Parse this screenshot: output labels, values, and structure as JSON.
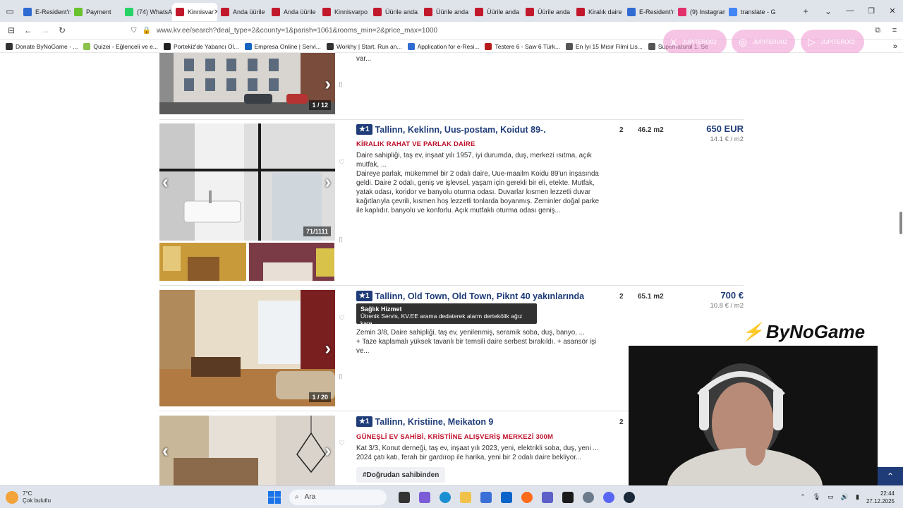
{
  "browser": {
    "tabs": [
      {
        "label": "E-Resident'n",
        "color": "#2f6bd2"
      },
      {
        "label": "Payment",
        "color": "#6ac22e"
      },
      {
        "label": "(74) WhatsA",
        "color": "#25d366"
      },
      {
        "label": "Kinnisvar",
        "color": "#c2182c",
        "active": true
      },
      {
        "label": "Anda üürile",
        "color": "#c2182c"
      },
      {
        "label": "Anda üürile",
        "color": "#c2182c"
      },
      {
        "label": "Kinnisvarpo",
        "color": "#c2182c"
      },
      {
        "label": "Üürile anda",
        "color": "#c2182c"
      },
      {
        "label": "Üürile anda",
        "color": "#c2182c"
      },
      {
        "label": "Üürile anda",
        "color": "#c2182c"
      },
      {
        "label": "Üürile anda",
        "color": "#c2182c"
      },
      {
        "label": "Kiralık daire",
        "color": "#c2182c"
      },
      {
        "label": "E-Resident'n",
        "color": "#2f6bd2"
      },
      {
        "label": "(9) Instagran",
        "color": "#e1306c"
      },
      {
        "label": "translate - G",
        "color": "#4285f4"
      }
    ],
    "url": "www.kv.ee/search?deal_type=2&county=1&parish=1061&rooms_min=2&price_max=1000",
    "bookmarks": [
      {
        "label": "Donate ByNoGame - ...",
        "color": "#333"
      },
      {
        "label": "Quizei - Eğlenceli ve e...",
        "color": "#8bc34a"
      },
      {
        "label": "Portekiz'de Yabancı Ol...",
        "color": "#222"
      },
      {
        "label": "Empresa Online | Servi...",
        "color": "#1565c0"
      },
      {
        "label": "Workhy | Start, Run an...",
        "color": "#333"
      },
      {
        "label": "Application for e-Resi...",
        "color": "#2f6bd2"
      },
      {
        "label": "Testere 6 - Saw 6 Türk...",
        "color": "#b71c1c"
      },
      {
        "label": "En İyi 15 Mısır Filmi Lis...",
        "color": "#555"
      },
      {
        "label": "Supernatural 1. Se",
        "color": "#555"
      }
    ],
    "social": [
      {
        "icon": "X",
        "handle": "JUPITERO02"
      },
      {
        "icon": "◎",
        "handle": "JUPITERO02"
      },
      {
        "icon": "▷",
        "handle": "JUPITERO02"
      }
    ]
  },
  "listings": [
    {
      "title": "",
      "subtitle": "",
      "desc": "var...",
      "counter": "1 / 12"
    },
    {
      "rank": "1",
      "title": "Tallinn, Keklinn, Uus-postam, Koidut 89-.",
      "subtitle": "KİRALIK RAHAT VE PARLAK DAİRE",
      "desc": "Daire sahipliği, taş ev, inşaat yılı 1957, iyi durumda, duş, merkezi ısıtma, açık mutfak, ...\nDaireye parlak, mükemmel bir 2 odalı daire, Uue-maailm Koidu 89'un inşasında geldi. Daire 2 odalı, geniş ve işlevsel, yaşam için gerekli bir eli, etekte. Mutfak, yatak odası, koridor ve banyolu oturma odası. Duvarlar kısmen lezzetli duvar kağıtlarıyla çevrili, kısmen hoş lezzetli tonlarda boyanmış. Zeminler doğal parke ile kaplıdır. banyolu ve konforlu. Açık mutfaklı oturma odası geniş...",
      "rooms": "2",
      "area": "46.2 m2",
      "price": "650 EUR",
      "price_m2": "14.1 € / m2",
      "counter": "71/1111"
    },
    {
      "rank": "1",
      "title": "Tallinn, Old Town, Old Town, Piknt 40 yakınlarında",
      "subtitle": "",
      "desc": "Zemin 3/8, Daire sahipliği, taş ev, yenilenmiş, seramik soba, duş, banyo, ...\n+ Taze kaplamalı yüksek tavanlı bir temsili daire serbest bırakıldı. + asansör işi ve...",
      "rooms": "2",
      "area": "65.1 m2",
      "price": "700 €",
      "price_m2": "10.8 € / m2",
      "counter": "1 / 20"
    },
    {
      "rank": "1",
      "title": "Tallinn, Kristiine, Meikaton 9",
      "subtitle": "GÜNEŞLİ EV SAHİBİ, KRİSTİİNE ALIŞVERİŞ MERKEZİ 300M",
      "desc": "Kat 3/3, Konut derneği, taş ev, inşaat yılı 2023, yeni, elektrikli soba, duş, yeni ...\n2024 çatı katı, ferah bir gardırop ile harika, yeni bir 2 odalı daire bekliyor...",
      "rooms": "2",
      "tag": "#Doğrudan sahibinden"
    }
  ],
  "tooltip": {
    "title": "Sağlık Hizmet",
    "text": "Ütrenik Servis, KV.EE arama dedaterek alarm dertekölik ağız kare."
  },
  "overlay": {
    "logo": "ByNoGame"
  },
  "taskbar": {
    "temp": "7°C",
    "weather": "Çok bulutlu",
    "search": "Ara",
    "time": "22:44",
    "date": "27.12.2025"
  }
}
